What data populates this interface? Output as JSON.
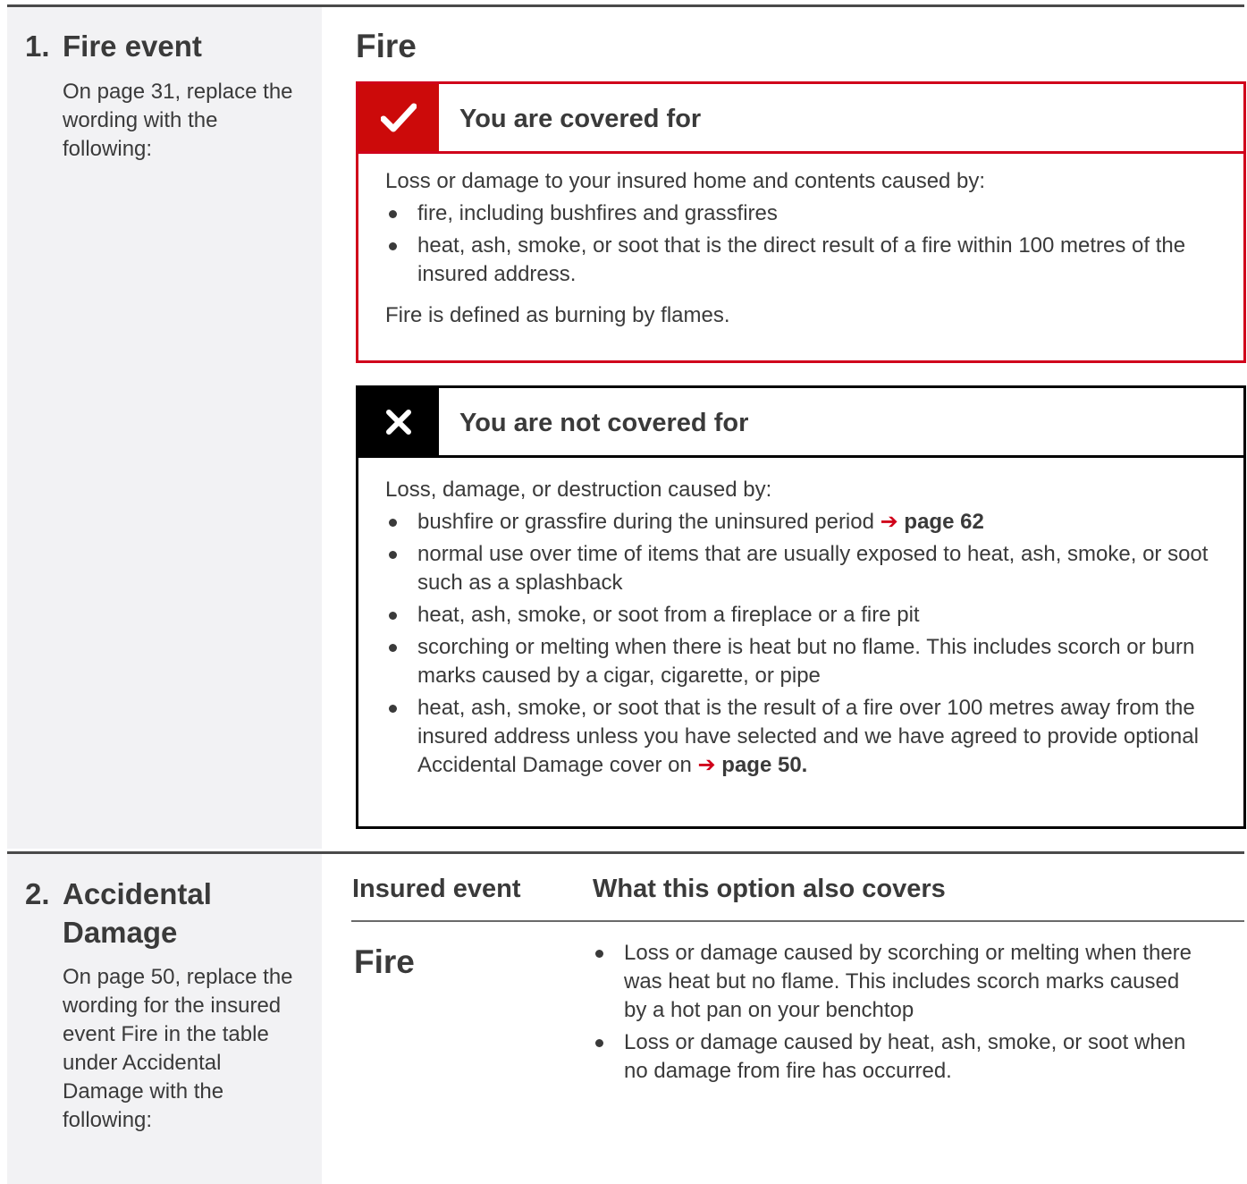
{
  "section1": {
    "number": "1.",
    "title": "Fire event",
    "instruction": "On page 31, replace the wording with the following:",
    "heading": "Fire",
    "covered": {
      "icon": "checkmark-icon",
      "title": "You are covered for",
      "intro": "Loss or damage to your insured home and contents caused by:",
      "items": [
        "fire, including bushfires and grassfires",
        "heat, ash, smoke, or soot that is the direct result of a fire within 100 metres of the insured address."
      ],
      "note": "Fire is defined as burning by flames."
    },
    "not_covered": {
      "icon": "cross-icon",
      "title": "You are not covered for",
      "intro": "Loss, damage, or destruction caused by:",
      "items": [
        {
          "text": "bushfire or grassfire during the uninsured period ",
          "arrow": "➔",
          "ref": "page 62"
        },
        {
          "text": "normal use over time of items that are usually exposed to heat, ash, smoke, or soot such as a splashback"
        },
        {
          "text": "heat, ash, smoke, or soot from a fireplace or a fire pit"
        },
        {
          "text": "scorching or melting when there is heat but no flame. This includes scorch or burn marks caused by a cigar, cigarette, or pipe"
        },
        {
          "text": "heat, ash, smoke, or soot that is the result of a fire over 100 metres away from the insured address unless you have selected and we have agreed to provide optional Accidental Damage cover on ",
          "arrow": "➔",
          "ref": "page 50."
        }
      ]
    }
  },
  "section2": {
    "number": "2.",
    "title": "Accidental Damage",
    "instruction": "On page 50, replace the wording for the insured event Fire in the table under Accidental Damage with the following:",
    "table": {
      "col1": "Insured event",
      "col2": "What this option also covers",
      "event": "Fire",
      "items": [
        "Loss or damage caused by scorching or melting when there was heat but no flame. This includes scorch marks caused by a hot pan on your benchtop",
        "Loss or damage caused by heat, ash, smoke, or soot when no damage from fire has occurred."
      ]
    }
  },
  "colors": {
    "accent_red": "#d0021b",
    "text": "#3a3a3a",
    "sidebar_bg": "#f2f2f4"
  }
}
